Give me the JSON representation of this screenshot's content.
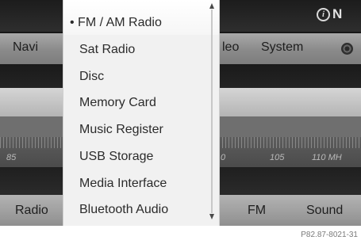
{
  "status": {
    "info_icon": "i",
    "indicator": "N"
  },
  "main_menu": {
    "items": [
      {
        "label": "Navi"
      },
      {
        "label": "leo"
      },
      {
        "label": "System"
      }
    ],
    "gear_icon": "settings-gear"
  },
  "scale": {
    "labels": [
      "85",
      "0",
      "105",
      "110 MH"
    ]
  },
  "bottom_bar": {
    "items": [
      {
        "label": "Radio"
      },
      {
        "label": "FM"
      },
      {
        "label": "Sound"
      }
    ]
  },
  "dropdown": {
    "selected_index": 0,
    "items": [
      {
        "label": "• FM / AM Radio"
      },
      {
        "label": "Sat Radio"
      },
      {
        "label": "Disc"
      },
      {
        "label": "Memory Card"
      },
      {
        "label": "Music Register"
      },
      {
        "label": "USB Storage"
      },
      {
        "label": "Media Interface"
      },
      {
        "label": "Bluetooth Audio"
      }
    ]
  },
  "caption": "P82.87-8021-31"
}
